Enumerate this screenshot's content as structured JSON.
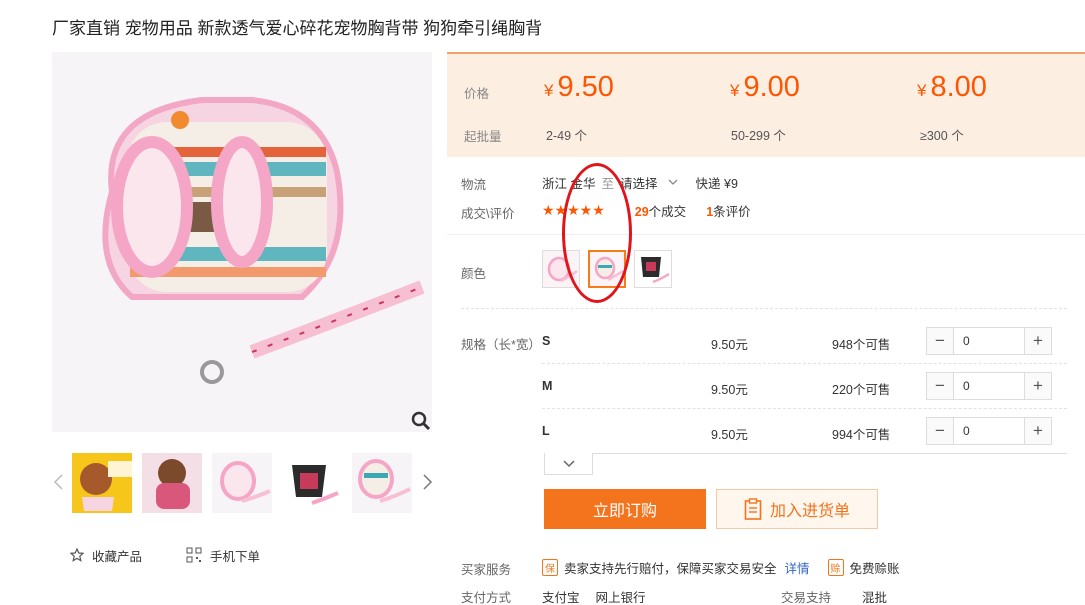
{
  "product": {
    "title": "厂家直销 宠物用品 新款透气爱心碎花宠物胸背带 狗狗牵引绳胸背"
  },
  "gallery": {
    "collect_label": "收藏产品",
    "mobile_order_label": "手机下单"
  },
  "price_panel": {
    "price_label": "价格",
    "min_qty_label": "起批量",
    "currency": "¥",
    "tiers": [
      {
        "price": "9.50",
        "qty": "2-49 个"
      },
      {
        "price": "9.00",
        "qty": "50-299 个"
      },
      {
        "price": "8.00",
        "qty": "≥300 个"
      }
    ]
  },
  "logistics": {
    "label": "物流",
    "origin": "浙江 金华",
    "to": "至",
    "dest_placeholder": "请选择",
    "express": "快递 ¥9"
  },
  "deals": {
    "label": "成交\\评价",
    "stars": "★★★★★",
    "deal_count": "29",
    "deal_suffix": "个成交",
    "review_count": "1",
    "review_suffix": "条评价"
  },
  "color": {
    "label": "颜色"
  },
  "spec": {
    "label": "规格（长*宽）",
    "sizes": [
      {
        "name": "S",
        "price": "9.50元",
        "stock": "948个可售",
        "qty": "0"
      },
      {
        "name": "M",
        "price": "9.50元",
        "stock": "220个可售",
        "qty": "0"
      },
      {
        "name": "L",
        "price": "9.50元",
        "stock": "994个可售",
        "qty": "0"
      }
    ]
  },
  "actions": {
    "order_label": "立即订购",
    "cart_label": "加入进货单"
  },
  "service": {
    "label": "买家服务",
    "guarantee_icon": "保",
    "guarantee_text": "卖家支持先行赔付，保障买家交易安全",
    "details_link": "详情",
    "free_icon": "赊",
    "free_text": "免费赊账"
  },
  "payment": {
    "label": "支付方式",
    "methods": [
      "支付宝",
      "网上银行"
    ],
    "trade_label": "交易支持",
    "trade_value": "混批"
  },
  "colors": {
    "accent": "#ff5500",
    "button": "#f4731d",
    "panel_bg": "#fdeee2",
    "annotation": "#e0141b"
  }
}
